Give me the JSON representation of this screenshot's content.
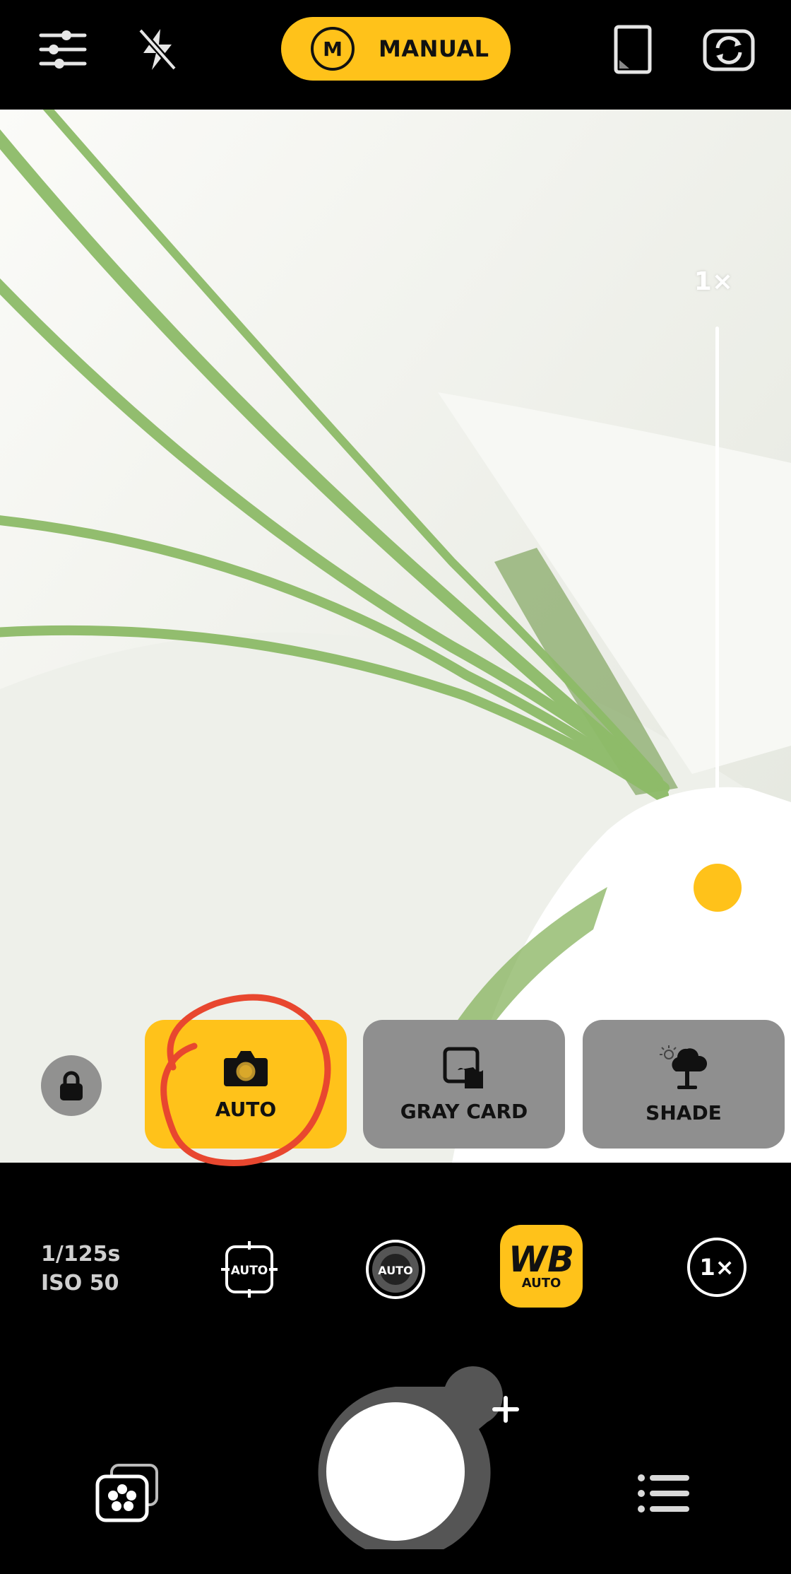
{
  "top_bar": {
    "mode_icon_letter": "M",
    "mode_label": "MANUAL",
    "icons": [
      "sliders-icon",
      "flash-off-icon",
      "aspect-ratio-icon",
      "switch-camera-icon"
    ]
  },
  "zoom": {
    "label": "1×",
    "level": 0.0
  },
  "white_balance_presets": [
    {
      "label": "AUTO",
      "icon": "camera-icon",
      "selected": true
    },
    {
      "label": "GRAY CARD",
      "icon": "gray-card-icon",
      "selected": false
    },
    {
      "label": "SHADE",
      "icon": "shade-tree-icon",
      "selected": false
    }
  ],
  "settings_row": {
    "shutter": "1/125s",
    "iso": "ISO 50",
    "focus_label": "AUTO",
    "aperture_label": "AUTO",
    "wb_title": "WB",
    "wb_sub": "AUTO",
    "zoom_label": "1×"
  },
  "colors": {
    "accent": "#ffc21a",
    "annotation": "#e8472f",
    "card_gray": "#8f8f8f"
  }
}
